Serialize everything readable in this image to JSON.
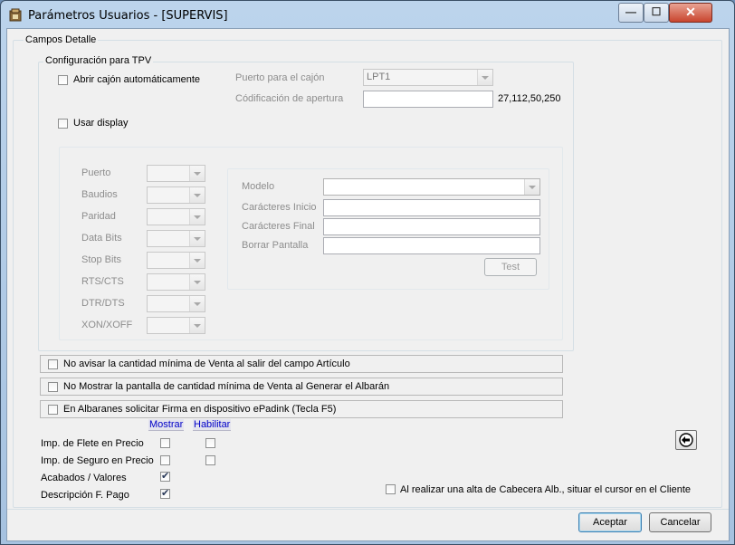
{
  "window": {
    "title": "Parámetros Usuarios - [SUPERVIS]",
    "min_glyph": "—",
    "max_glyph": "☐",
    "close_glyph": "✕"
  },
  "campos_detalle": {
    "label": "Campos Detalle"
  },
  "tpv": {
    "label": "Configuración para TPV",
    "abrir_cajon": {
      "label": "Abrir cajón automáticamente",
      "checked": false
    },
    "puerto_cajon": {
      "label": "Puerto para el cajón",
      "value": "LPT1"
    },
    "codificacion": {
      "label": "Códificación de apertura",
      "value": "",
      "hint": "27,112,50,250"
    },
    "usar_display": {
      "label": "Usar display",
      "checked": false
    },
    "serial": {
      "puerto": "Puerto",
      "baudios": "Baudios",
      "paridad": "Paridad",
      "data_bits": "Data Bits",
      "stop_bits": "Stop Bits",
      "rts_cts": "RTS/CTS",
      "dtr_dts": "DTR/DTS",
      "xon_xoff": "XON/XOFF"
    },
    "display": {
      "modelo": "Modelo",
      "car_inicio": "Carácteres Inicio",
      "car_final": "Carácteres Final",
      "borrar": "Borrar Pantalla",
      "test": "Test"
    }
  },
  "options": {
    "no_avisar": "No avisar la cantidad mínima de Venta al salir del campo Artículo",
    "no_mostrar": "No Mostrar la pantalla de cantidad mínima de Venta al Generar el Albarán",
    "firma": "En Albaranes solicitar Firma en dispositivo ePadink (Tecla F5)"
  },
  "grid": {
    "col_mostrar": "Mostrar",
    "col_habilitar": "Habilitar",
    "rows": [
      {
        "label": "Imp. de Flete en Precio",
        "mostrar": false,
        "habilitar": false
      },
      {
        "label": "Imp. de Seguro en Precio",
        "mostrar": false,
        "habilitar": false
      },
      {
        "label": "Acabados / Valores",
        "mostrar": true
      },
      {
        "label": "Descripción F. Pago",
        "mostrar": true
      }
    ]
  },
  "cursor_cliente": {
    "label": "Al realizar una alta de Cabecera Alb., situar el cursor en el Cliente",
    "checked": false
  },
  "buttons": {
    "aceptar": "Aceptar",
    "cancelar": "Cancelar"
  }
}
